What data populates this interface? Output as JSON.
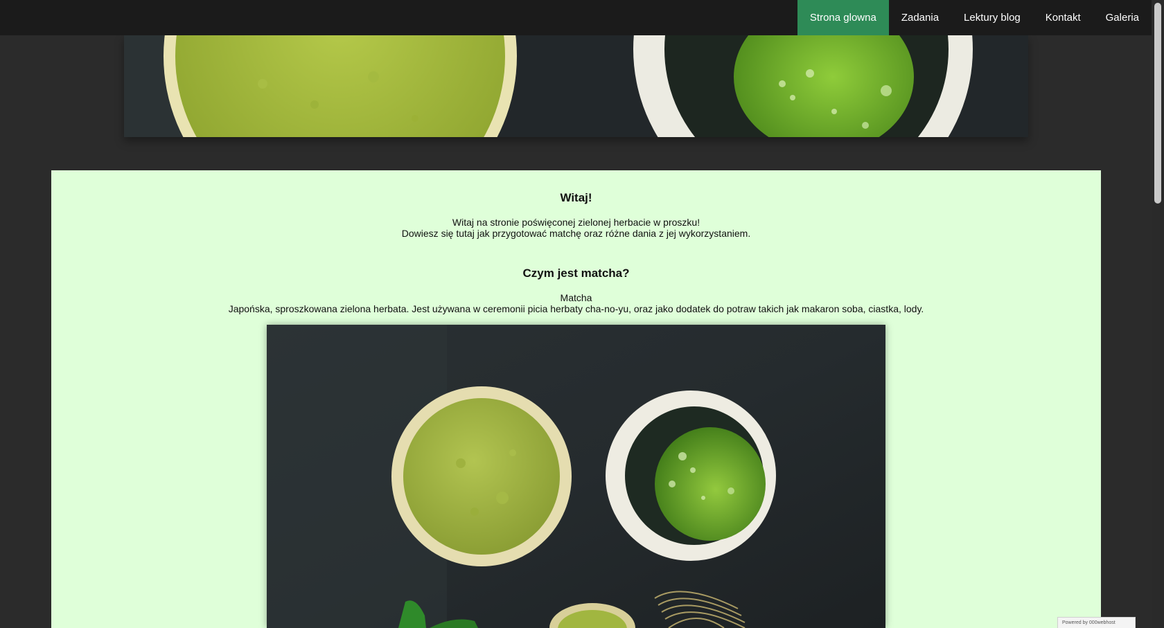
{
  "nav": {
    "items": [
      {
        "label": "Strona glowna",
        "active": true
      },
      {
        "label": "Zadania",
        "active": false
      },
      {
        "label": "Lektury blog",
        "active": false
      },
      {
        "label": "Kontakt",
        "active": false
      },
      {
        "label": "Galeria",
        "active": false
      }
    ]
  },
  "banner": {
    "image": "matcha-banner-image"
  },
  "main": {
    "welcome_title": "Witaj!",
    "welcome_line1": "Witaj na stronie poświęconej zielonej herbacie w proszku!",
    "welcome_line2": "Dowiesz się tutaj jak przygotować matchę oraz różne dania z jej wykorzystaniem.",
    "what_title": "Czym jest matcha?",
    "what_term": "Matcha",
    "what_desc": "Japońska, sproszkowana zielona herbata. Jest używana w ceremonii picia herbaty cha-no-yu, oraz jako dodatek do potraw takich jak makaron soba, ciastka, lody.",
    "image": "matcha-hero-image"
  },
  "badge": {
    "text": "Powered by 000webhost"
  },
  "colors": {
    "accent": "#2e8b57",
    "nav_bg": "#1b1b1b",
    "page_bg": "#2b2b2b",
    "panel_bg": "#dfffd9"
  }
}
